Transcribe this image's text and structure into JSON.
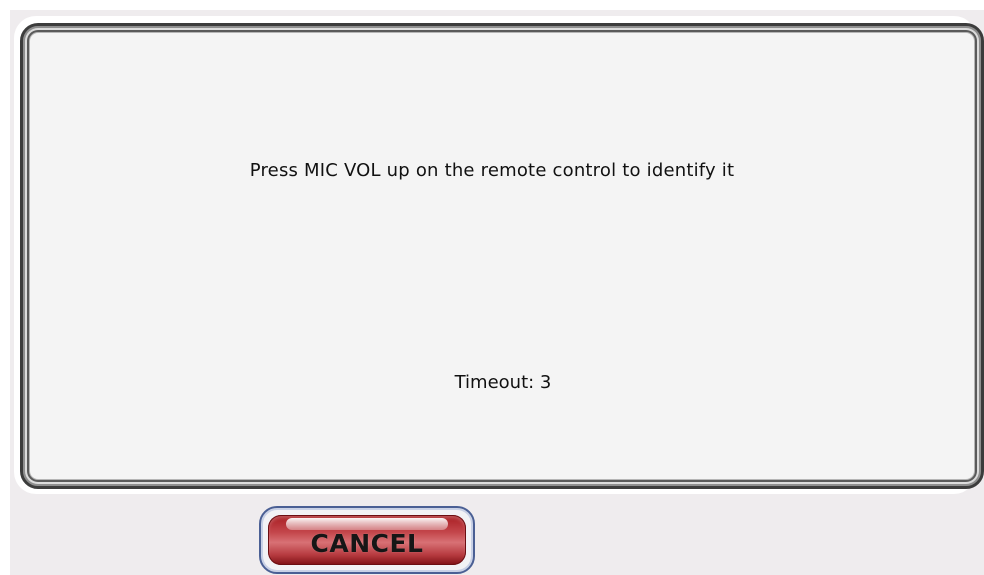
{
  "dialog": {
    "message": "Press MIC VOL up on the remote control to identify it",
    "timeout_text": "Timeout: 3"
  },
  "buttons": {
    "cancel_label": "CANCEL"
  },
  "colors": {
    "background": "#efecee",
    "dialog_background": "#f4f4f4",
    "cancel_button": "#c4474c",
    "cancel_border": "#4a5f94"
  }
}
